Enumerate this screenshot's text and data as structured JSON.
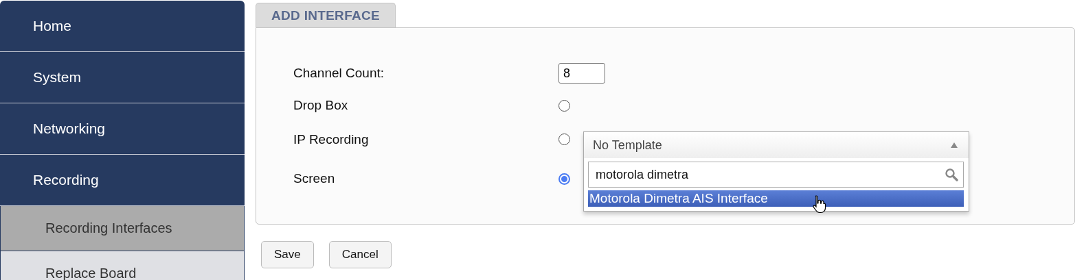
{
  "sidebar": {
    "items": [
      {
        "label": "Home",
        "selected": false
      },
      {
        "label": "System",
        "selected": false
      },
      {
        "label": "Networking",
        "selected": false
      },
      {
        "label": "Recording",
        "selected": false,
        "children": [
          {
            "label": "Recording Interfaces",
            "selected": true
          },
          {
            "label": "Replace Board",
            "selected": false
          }
        ]
      }
    ]
  },
  "tab": {
    "label": "ADD INTERFACE"
  },
  "form": {
    "rows": [
      {
        "kind": "number",
        "label": "Channel Count:",
        "value": "8"
      },
      {
        "kind": "radio",
        "label": "Drop Box",
        "selected": false
      },
      {
        "kind": "radio",
        "label": "IP Recording",
        "selected": false,
        "dropdown": {
          "value": "No Template",
          "expanded": true,
          "search": "motorola dimetra",
          "options": [
            {
              "label": "Motorola Dimetra AIS Interface",
              "highlighted": true
            }
          ]
        }
      },
      {
        "kind": "radio",
        "label": "Screen",
        "selected": true
      }
    ]
  },
  "buttons": [
    "Save",
    "Cancel"
  ]
}
